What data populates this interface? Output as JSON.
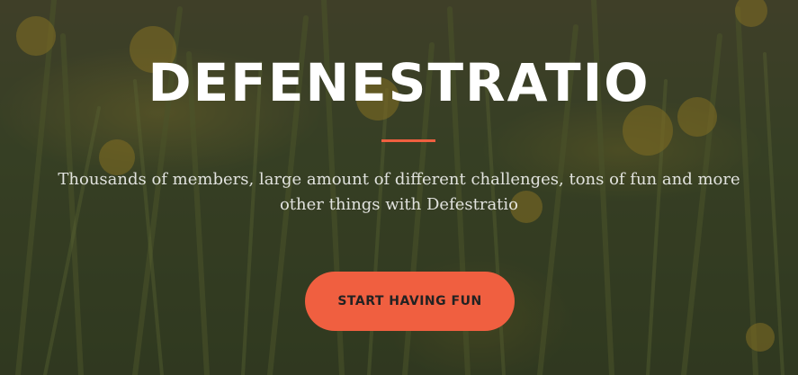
{
  "hero": {
    "title": "DEFENESTRATIO",
    "subtitle": "Thousands of members, large amount of different challenges, tons of fun and more other things with Defestratio",
    "cta_label": "START HAVING FUN"
  },
  "colors": {
    "accent": "#f05f40",
    "title_text": "#ffffff",
    "background_overlay": "#1e1e14"
  },
  "background": {
    "subject": "dandelion field"
  }
}
